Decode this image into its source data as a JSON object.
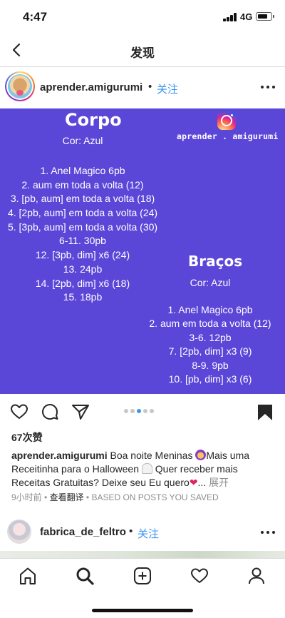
{
  "status_bar": {
    "time": "4:47",
    "network": "4G"
  },
  "nav": {
    "title": "发现",
    "back_icon": "chevron-left-icon"
  },
  "post": {
    "username": "aprender.amigurumi",
    "separator": "•",
    "follow_label": "关注",
    "image": {
      "background": "#5a47d8",
      "corpo": {
        "title": "Corpo",
        "color_line": "Cor: Azul",
        "rows": [
          "1. Anel Magico 6pb",
          "2. aum em toda a volta (12)",
          "3. [pb, aum] em toda a volta (18)",
          "4. [2pb, aum] em toda a volta (24)",
          "5. [3pb, aum] em toda a volta (30)",
          "6-11. 30pb",
          "12. [3pb, dim] x6 (24)",
          "13. 24pb",
          "14. [2pb, dim] x6 (18)",
          "15. 18pb"
        ]
      },
      "bracos": {
        "title": "Braços",
        "color_line": "Cor: Azul",
        "rows": [
          "1. Anel Magico 6pb",
          "2. aum em toda a volta (12)",
          "3-6. 12pb",
          "7. [2pb, dim] x3 (9)",
          "8-9. 9pb",
          "10. [pb, dim] x3 (6)"
        ]
      },
      "watermark": {
        "icon": "instagram-logo-icon",
        "handle": "aprender . amigurumi"
      }
    },
    "carousel": {
      "count": 5,
      "active_index": 2
    },
    "likes": "67次赞",
    "caption": {
      "username": "aprender.amigurumi",
      "part1": " Boa noite Meninas",
      "part2": "Mais uma Receitinha para o Halloween",
      "part3": " Quer receber mais Receitas Gratuitas? Deixe seu Eu quero",
      "ellipsis": "... ",
      "more_label": "展开"
    },
    "meta": {
      "time_ago": "9小时前",
      "dot": " • ",
      "translate_label": "查看翻译",
      "based_on": " • BASED ON POSTS YOU SAVED"
    }
  },
  "next_post": {
    "username": "fabrica_de_feltro",
    "separator": "•",
    "follow_label": "关注"
  },
  "tab_bar": {
    "items": [
      "home-icon",
      "search-icon",
      "new-post-icon",
      "activity-heart-icon",
      "profile-icon"
    ]
  },
  "colors": {
    "accent_blue": "#3897f0",
    "post_bg": "#5a47d8",
    "text": "#262626",
    "muted": "#8e8e8e"
  }
}
